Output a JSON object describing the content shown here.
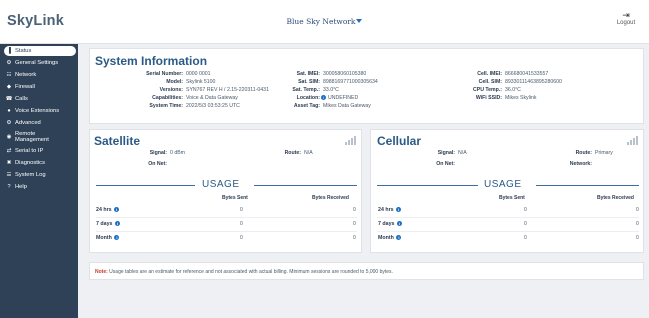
{
  "header": {
    "logo": "SkyLink",
    "brand": "Blue Sky Network",
    "logout_label": "Logout",
    "logout_icon": "logout-arrow-icon"
  },
  "sidebar": {
    "items": [
      {
        "label": "Status",
        "icon": "signal-bars-icon",
        "active": true
      },
      {
        "label": "General Settings",
        "icon": "gear-icon"
      },
      {
        "label": "Network",
        "icon": "network-icon"
      },
      {
        "label": "Firewall",
        "icon": "shield-icon"
      },
      {
        "label": "Calls",
        "icon": "phone-icon"
      },
      {
        "label": "Voice Extensions",
        "icon": "chat-bubble-icon"
      },
      {
        "label": "Advanced",
        "icon": "gear-icon"
      },
      {
        "label": "Remote",
        "label2": "Management",
        "icon": "remote-icon"
      },
      {
        "label": "Serial to IP",
        "icon": "arrows-icon"
      },
      {
        "label": "Diagnostics",
        "icon": "tools-icon"
      },
      {
        "label": "System Log",
        "icon": "list-icon"
      },
      {
        "label": "Help",
        "icon": "question-icon"
      }
    ]
  },
  "system": {
    "title": "System Information",
    "left": [
      {
        "k": "Serial Number:",
        "v": "0000 0001"
      },
      {
        "k": "Model:",
        "v": "Skylink 5100"
      },
      {
        "k": "Versions:",
        "v": "SYN767 REV H / 2.15-220311-0431"
      },
      {
        "k": "Capabilities:",
        "v": "Voice & Data Gateway"
      },
      {
        "k": "System Time:",
        "v": "2022/5/3 03:53:25 UTC"
      }
    ],
    "middle": [
      {
        "k": "Sat. IMEI:",
        "v": "300058060105380"
      },
      {
        "k": "Sat. SIM:",
        "v": "8988169771000305634"
      },
      {
        "k": "Sat. Temp.:",
        "v": "33.0°C"
      },
      {
        "k": "Location:",
        "v": "UNDEFINED"
      },
      {
        "k": "Asset Tag:",
        "v": "Mikes Data Gateway"
      }
    ],
    "right": [
      {
        "k": "Cell. IMEI:",
        "v": "866680041533557"
      },
      {
        "k": "Cell. SIM:",
        "v": "89330111463895280600"
      },
      {
        "k": "CPU Temp.:",
        "v": "36.0°C"
      },
      {
        "k": "WiFi SSID:",
        "v": "Mikes Skylink"
      }
    ]
  },
  "satellite": {
    "title": "Satellite",
    "signal_label": "Signal:",
    "signal_value": "0 dBm",
    "route_label": "Route:",
    "route_value": "N/A",
    "onnet_label": "On Net:",
    "onnet_value": ""
  },
  "cellular": {
    "title": "Cellular",
    "signal_label": "Signal:",
    "signal_value": "N/A",
    "route_label": "Route:",
    "route_value": "Primary",
    "onnet_label": "On Net:",
    "onnet_value": "",
    "network_label": "Network:",
    "network_value": ""
  },
  "usage": {
    "title": "USAGE",
    "col_sent": "Bytes Sent",
    "col_received": "Bytes Received",
    "rows": [
      {
        "label": "24 hrs",
        "sent": "0",
        "received": "0"
      },
      {
        "label": "7 days",
        "sent": "0",
        "received": "0"
      },
      {
        "label": "Month",
        "sent": "0",
        "received": "0"
      }
    ]
  },
  "note": {
    "label": "Note:",
    "text": "Usage tables are an estimate for reference and not associated with actual billing. Minimum sessions are rounded to 5,000 bytes."
  },
  "colors": {
    "sidebar_bg": "#2e4157",
    "title_blue": "#2b5a86",
    "info_icon": "#1b6fc1",
    "note_label": "#c43a2b"
  }
}
